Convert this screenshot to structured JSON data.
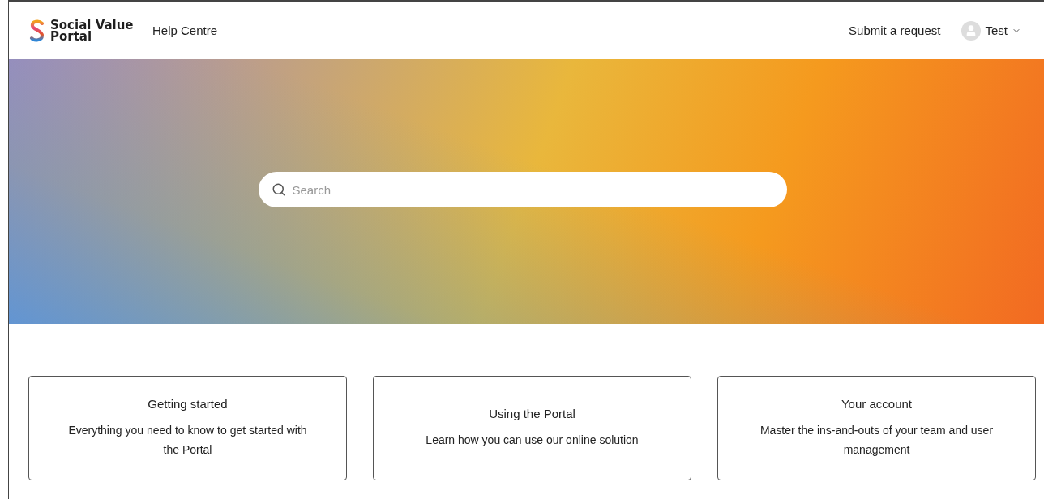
{
  "header": {
    "logo_text": "Social Value Portal",
    "title": "Help Centre",
    "submit_link": "Submit a request",
    "user": {
      "name": "Test"
    }
  },
  "hero": {
    "search": {
      "placeholder": "Search"
    }
  },
  "cards": [
    {
      "title": "Getting started",
      "description": "Everything you need to know to get started with the Portal"
    },
    {
      "title": "Using the Portal",
      "description": "Learn how you can use our online solution"
    },
    {
      "title": "Your account",
      "description": "Master the ins-and-outs of your team and user management"
    }
  ]
}
